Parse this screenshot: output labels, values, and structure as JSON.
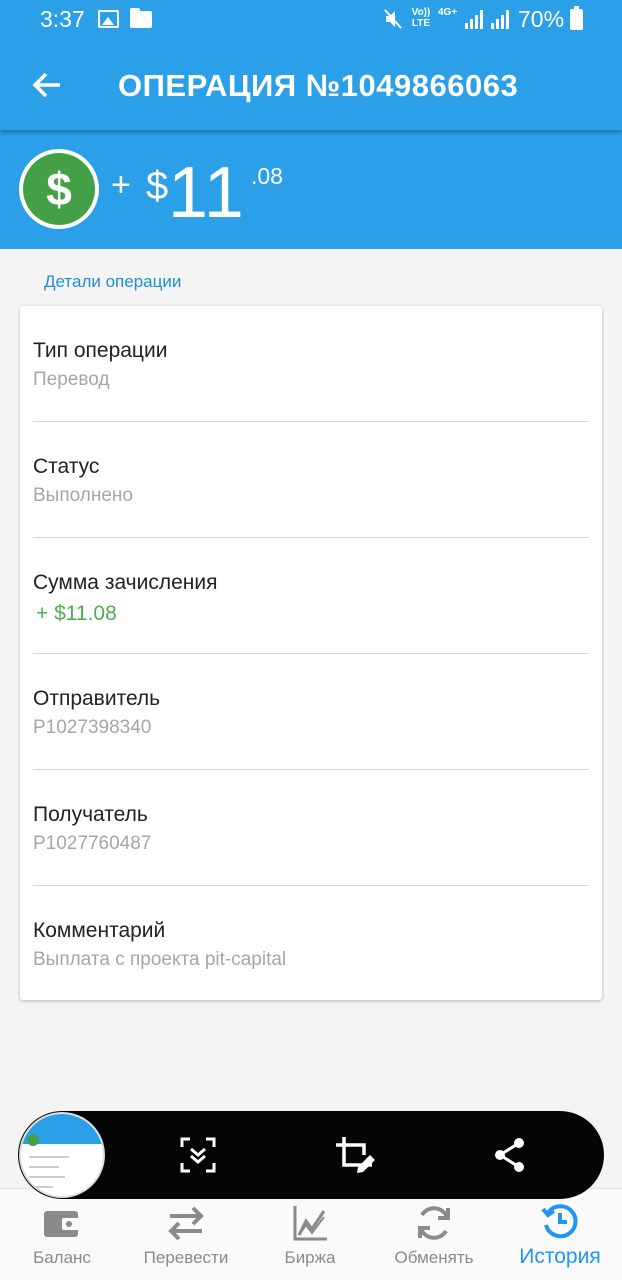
{
  "status_bar": {
    "time": "3:37",
    "volte_label": "Vo)) LTE",
    "network_label": "4G+",
    "battery": "70%"
  },
  "header": {
    "title": "ОПЕРАЦИЯ №1049866063"
  },
  "amount": {
    "sign": "+",
    "currency": "$",
    "integer": "11",
    "decimal": ".08"
  },
  "details": {
    "section_label": "Детали операции",
    "rows": [
      {
        "label": "Тип операции",
        "value": "Перевод"
      },
      {
        "label": "Статус",
        "value": "Выполнено"
      },
      {
        "label": "Сумма зачисления",
        "value": "+ $11.08"
      },
      {
        "label": "Отправитель",
        "value": "P1027398340"
      },
      {
        "label": "Получатель",
        "value": "P1027760487"
      },
      {
        "label": "Комментарий",
        "value": "Выплата с проекта pit-capital"
      }
    ]
  },
  "bottom_nav": {
    "items": [
      {
        "label": "Баланс",
        "icon": "wallet-icon"
      },
      {
        "label": "Перевести",
        "icon": "transfer-icon"
      },
      {
        "label": "Биржа",
        "icon": "chart-icon"
      },
      {
        "label": "Обменять",
        "icon": "exchange-icon"
      },
      {
        "label": "История",
        "icon": "history-icon"
      }
    ],
    "active_index": 4
  },
  "colors": {
    "primary": "#2ba0e8",
    "accent_green": "#4caf50",
    "active_nav": "#2196f3",
    "link": "#1f8fd6"
  }
}
